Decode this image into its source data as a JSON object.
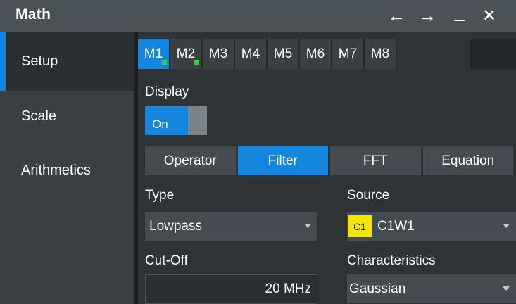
{
  "window": {
    "title": "Math",
    "controls": {
      "back": "←",
      "forward": "→",
      "minimize": "_",
      "close": "✕"
    }
  },
  "sidebar": {
    "items": [
      {
        "label": "Setup",
        "active": true
      },
      {
        "label": "Scale",
        "active": false
      },
      {
        "label": "Arithmetics",
        "active": false
      }
    ]
  },
  "math_tabs": [
    {
      "label": "M1",
      "active": true,
      "indicator": "green"
    },
    {
      "label": "M2",
      "active": false,
      "indicator": "green"
    },
    {
      "label": "M3",
      "active": false
    },
    {
      "label": "M4",
      "active": false
    },
    {
      "label": "M5",
      "active": false
    },
    {
      "label": "M6",
      "active": false
    },
    {
      "label": "M7",
      "active": false
    },
    {
      "label": "M8",
      "active": false
    }
  ],
  "display": {
    "label": "Display",
    "toggle_value": "On"
  },
  "mode_tabs": [
    {
      "label": "Operator",
      "active": false
    },
    {
      "label": "Filter",
      "active": true
    },
    {
      "label": "FFT",
      "active": false
    },
    {
      "label": "Equation",
      "active": false
    }
  ],
  "type": {
    "label": "Type",
    "value": "Lowpass"
  },
  "source": {
    "label": "Source",
    "badge": "C1",
    "value": "C1W1"
  },
  "cutoff": {
    "label": "Cut-Off",
    "value": "20 MHz"
  },
  "characteristics": {
    "label": "Characteristics",
    "value": "Gaussian"
  },
  "colors": {
    "accent": "#1486dd",
    "indicator": "#34d134",
    "badge": "#f5e400"
  }
}
